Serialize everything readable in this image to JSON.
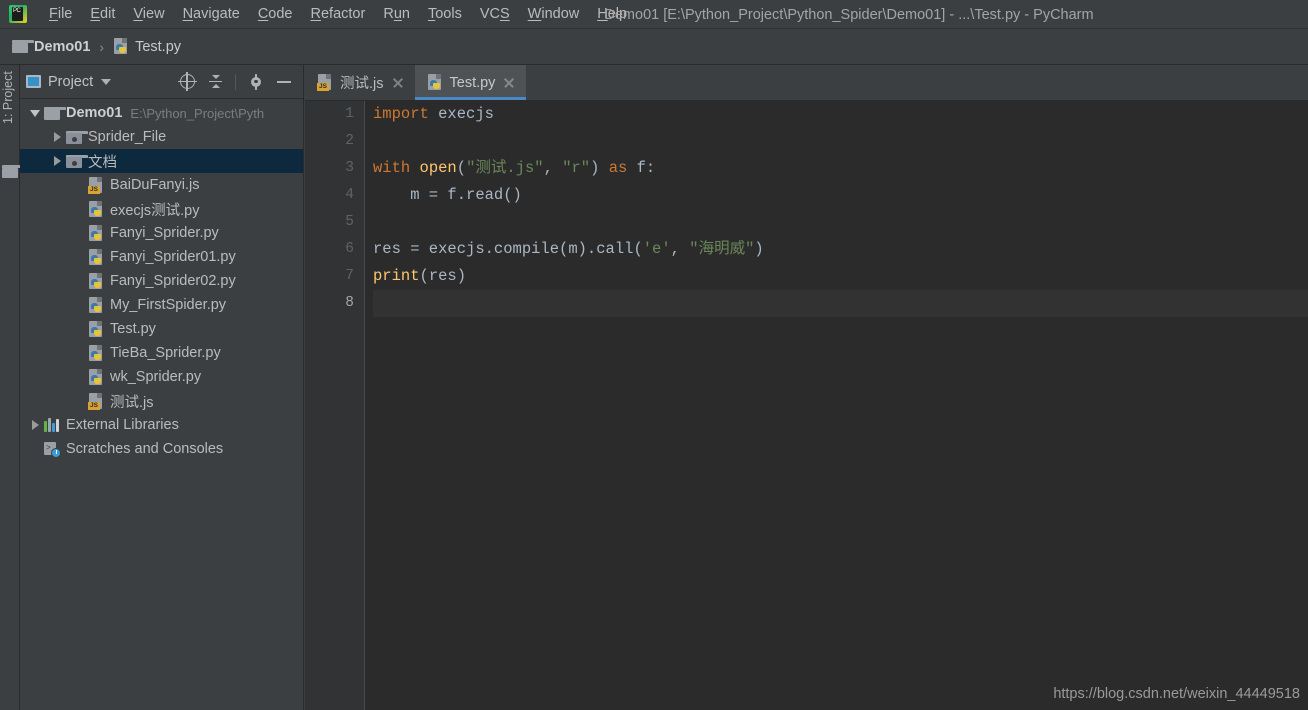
{
  "window": {
    "title": "Demo01 [E:\\Python_Project\\Python_Spider\\Demo01] - ...\\Test.py - PyCharm",
    "logo_icon": "pycharm-logo-icon"
  },
  "menu": {
    "items": [
      {
        "label": "File"
      },
      {
        "label": "Edit"
      },
      {
        "label": "View"
      },
      {
        "label": "Navigate"
      },
      {
        "label": "Code"
      },
      {
        "label": "Refactor"
      },
      {
        "label": "Run"
      },
      {
        "label": "Tools"
      },
      {
        "label": "VCS"
      },
      {
        "label": "Window"
      },
      {
        "label": "Help"
      }
    ]
  },
  "breadcrumb": {
    "project": "Demo01",
    "separator": "›",
    "file": "Test.py"
  },
  "left_strip": {
    "label": "1: Project",
    "icon": "folder-icon"
  },
  "project_panel": {
    "title": "Project",
    "tools": [
      {
        "name": "locate-target-icon"
      },
      {
        "name": "collapse-all-icon"
      },
      {
        "name": "settings-gear-icon"
      },
      {
        "name": "minimize-icon"
      }
    ],
    "tree": [
      {
        "label": "Demo01",
        "subpath": "E:\\Python_Project\\Pyth",
        "icon": "folder-icon",
        "indent": 1,
        "expanded": true,
        "bold": true,
        "selected": false
      },
      {
        "label": "Sprider_File",
        "icon": "source-folder-icon",
        "indent": 2,
        "expanded": false,
        "bold": false,
        "selected": false
      },
      {
        "label": "文档",
        "icon": "source-folder-icon",
        "indent": 2,
        "expanded": false,
        "bold": false,
        "selected": true
      },
      {
        "label": "BaiDuFanyi.js",
        "icon": "js-file-icon",
        "indent": 3,
        "bold": false,
        "selected": false
      },
      {
        "label": "execjs测试.py",
        "icon": "python-file-icon",
        "indent": 3,
        "bold": false,
        "selected": false
      },
      {
        "label": "Fanyi_Sprider.py",
        "icon": "python-file-icon",
        "indent": 3,
        "bold": false,
        "selected": false
      },
      {
        "label": "Fanyi_Sprider01.py",
        "icon": "python-file-icon",
        "indent": 3,
        "bold": false,
        "selected": false
      },
      {
        "label": "Fanyi_Sprider02.py",
        "icon": "python-file-icon",
        "indent": 3,
        "bold": false,
        "selected": false
      },
      {
        "label": "My_FirstSpider.py",
        "icon": "python-file-icon",
        "indent": 3,
        "bold": false,
        "selected": false
      },
      {
        "label": "Test.py",
        "icon": "python-file-icon",
        "indent": 3,
        "bold": false,
        "selected": false
      },
      {
        "label": "TieBa_Sprider.py",
        "icon": "python-file-icon",
        "indent": 3,
        "bold": false,
        "selected": false
      },
      {
        "label": "wk_Sprider.py",
        "icon": "python-file-icon",
        "indent": 3,
        "bold": false,
        "selected": false
      },
      {
        "label": "测试.js",
        "icon": "js-file-icon",
        "indent": 3,
        "bold": false,
        "selected": false
      },
      {
        "label": "External Libraries",
        "icon": "external-libraries-icon",
        "indent": 1,
        "expanded": false,
        "bold": false,
        "selected": false
      },
      {
        "label": "Scratches and Consoles",
        "icon": "scratches-icon",
        "indent": 1,
        "bold": false,
        "selected": false
      }
    ]
  },
  "editor": {
    "tabs": [
      {
        "label": "测试.js",
        "icon": "js-file-icon",
        "active": false
      },
      {
        "label": "Test.py",
        "icon": "python-file-icon",
        "active": true
      }
    ],
    "line_numbers": [
      "1",
      "2",
      "3",
      "4",
      "5",
      "6",
      "7",
      "8"
    ],
    "current_line": 8,
    "code_lines": [
      {
        "n": 1,
        "tokens": [
          {
            "t": "import",
            "c": "kw"
          },
          {
            "t": " execjs",
            "c": "plain"
          }
        ]
      },
      {
        "n": 2,
        "tokens": []
      },
      {
        "n": 3,
        "tokens": [
          {
            "t": "with",
            "c": "kw"
          },
          {
            "t": " ",
            "c": "plain"
          },
          {
            "t": "open",
            "c": "fn"
          },
          {
            "t": "(",
            "c": "plain"
          },
          {
            "t": "\"测试.js\"",
            "c": "str"
          },
          {
            "t": ", ",
            "c": "plain"
          },
          {
            "t": "\"r\"",
            "c": "str"
          },
          {
            "t": ") ",
            "c": "plain"
          },
          {
            "t": "as",
            "c": "kw"
          },
          {
            "t": " f:",
            "c": "plain"
          }
        ]
      },
      {
        "n": 4,
        "tokens": [
          {
            "t": "    m = f.read()",
            "c": "plain"
          }
        ]
      },
      {
        "n": 5,
        "tokens": []
      },
      {
        "n": 6,
        "tokens": [
          {
            "t": "res = execjs.compile(m).call(",
            "c": "plain"
          },
          {
            "t": "'e'",
            "c": "str"
          },
          {
            "t": ", ",
            "c": "plain"
          },
          {
            "t": "\"海明威\"",
            "c": "str"
          },
          {
            "t": ")",
            "c": "plain"
          }
        ]
      },
      {
        "n": 7,
        "tokens": [
          {
            "t": "print",
            "c": "fn"
          },
          {
            "t": "(res)",
            "c": "plain"
          }
        ]
      },
      {
        "n": 8,
        "tokens": []
      }
    ]
  },
  "watermark": "https://blog.csdn.net/weixin_44449518",
  "colors": {
    "chrome": "#3c3f41",
    "editor_bg": "#2b2b2b",
    "gutter_bg": "#313335",
    "selection": "#0d293e",
    "accent": "#4a88c7",
    "keyword": "#cc7832",
    "string": "#6a8759",
    "function": "#ffc66d",
    "text": "#a9b7c6"
  }
}
